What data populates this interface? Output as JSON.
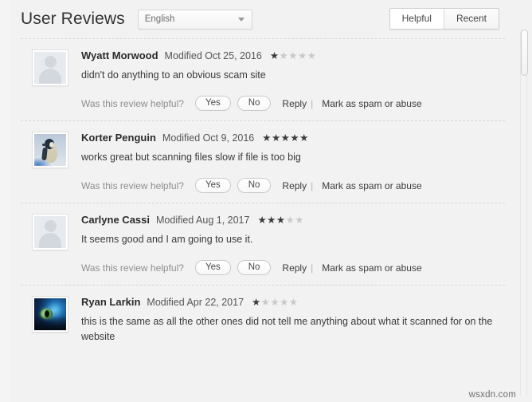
{
  "header": {
    "title": "User Reviews",
    "language_select": {
      "value": "English",
      "caret_icon": "chevron-down-icon"
    },
    "sort": {
      "helpful_label": "Helpful",
      "recent_label": "Recent",
      "active": "Helpful"
    }
  },
  "labels": {
    "helpful_question": "Was this review helpful?",
    "yes": "Yes",
    "no": "No",
    "reply": "Reply",
    "separator": "|",
    "mark_spam": "Mark as spam or abuse",
    "modified_prefix": "Modified"
  },
  "reviews": [
    {
      "author": "Wyatt Morwood",
      "modified": "Modified Oct 25, 2016",
      "rating": 1,
      "max_rating": 5,
      "text": "didn't do anything to an obvious scam site",
      "avatar": "default-person-avatar"
    },
    {
      "author": "Korter Penguin",
      "modified": "Modified Oct 9, 2016",
      "rating": 5,
      "max_rating": 5,
      "text": "works great but scanning files slow if file is too big",
      "avatar": "penguin-photo-avatar"
    },
    {
      "author": "Carlyne Cassi",
      "modified": "Modified Aug 1, 2017",
      "rating": 3,
      "max_rating": 5,
      "text": "It seems good and I am going to use it.",
      "avatar": "default-person-avatar"
    },
    {
      "author": "Ryan Larkin",
      "modified": "Modified Apr 22, 2017",
      "rating": 1,
      "max_rating": 5,
      "text": "this is the same as all the other ones did not tell me anything about what it scanned for on the website",
      "avatar": "nebula-eye-photo-avatar"
    }
  ],
  "watermark": "wsxdn.com",
  "colors": {
    "background": "#f2f2f2",
    "star_filled": "#3b3b3b",
    "star_empty": "#c9c9c9",
    "title_text": "#333333"
  }
}
